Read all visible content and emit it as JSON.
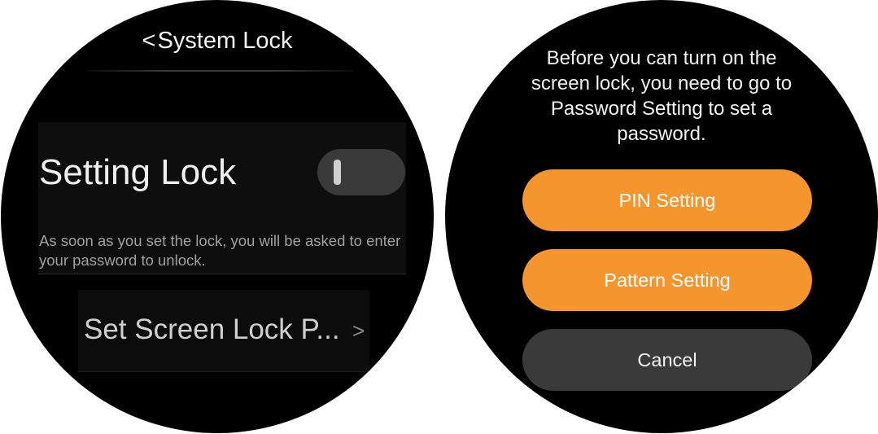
{
  "left_screen": {
    "header": {
      "back_chevron": "<",
      "title": "System Lock"
    },
    "setting_lock": {
      "label": "Setting Lock",
      "toggle_state": "off",
      "description": "As soon as you set the lock, you will be asked to enter your password to unlock."
    },
    "screen_lock_row": {
      "label": "Set Screen Lock P...",
      "chevron": ">"
    }
  },
  "right_screen": {
    "message": "Before you can turn on the screen lock, you need to go to Password Setting to set a password.",
    "buttons": {
      "pin": "PIN Setting",
      "pattern": "Pattern Setting",
      "cancel": "Cancel"
    }
  },
  "colors": {
    "background": "#000000",
    "accent_orange": "#f5952d",
    "secondary_button": "#3a3a3a"
  },
  "icons": [
    "chevron-left-icon",
    "chevron-right-icon"
  ]
}
